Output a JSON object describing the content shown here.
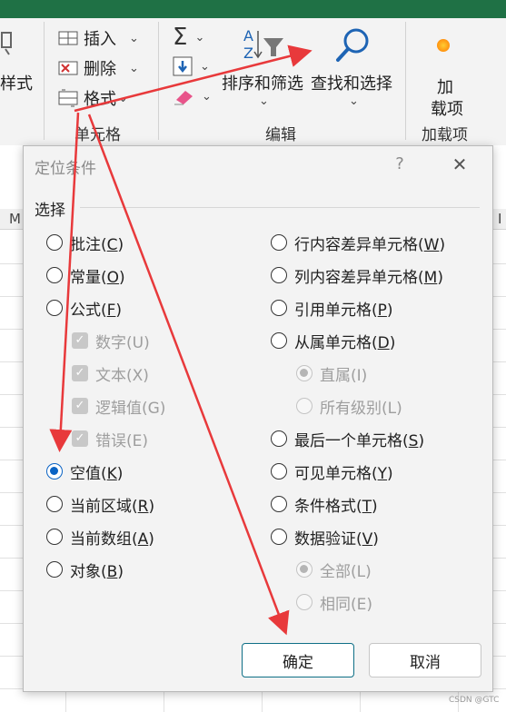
{
  "ribbon": {
    "left_partial_label": "样式",
    "cells_group": {
      "insert": "插入",
      "delete": "删除",
      "format": "格式",
      "label": "单元格"
    },
    "edit_group": {
      "sort_filter": "排序和筛选",
      "find_select": "查找和选择",
      "label": "编辑"
    },
    "addins_group": {
      "addins_line1": "加",
      "addins_line2": "载项",
      "label": "加载项"
    },
    "sheet_col_left": "M",
    "sheet_col_right": "I"
  },
  "dialog": {
    "title": "定位条件",
    "help": "?",
    "close": "✕",
    "section_label": "选择",
    "left_options": [
      {
        "text": "批注(",
        "key": "C",
        "tail": ")",
        "type": "radio",
        "checked": false,
        "disabled": false
      },
      {
        "text": "常量(",
        "key": "O",
        "tail": ")",
        "type": "radio",
        "checked": false,
        "disabled": false
      },
      {
        "text": "公式(",
        "key": "F",
        "tail": ")",
        "type": "radio",
        "checked": false,
        "disabled": false
      },
      {
        "text": "数字(U)",
        "type": "checkbox",
        "checked": true,
        "disabled": true
      },
      {
        "text": "文本(X)",
        "type": "checkbox",
        "checked": true,
        "disabled": true
      },
      {
        "text": "逻辑值(G)",
        "type": "checkbox",
        "checked": true,
        "disabled": true
      },
      {
        "text": "错误(E)",
        "type": "checkbox",
        "checked": true,
        "disabled": true
      },
      {
        "text": "空值(",
        "key": "K",
        "tail": ")",
        "type": "radio",
        "checked": true,
        "disabled": false
      },
      {
        "text": "当前区域(",
        "key": "R",
        "tail": ")",
        "type": "radio",
        "checked": false,
        "disabled": false
      },
      {
        "text": "当前数组(",
        "key": "A",
        "tail": ")",
        "type": "radio",
        "checked": false,
        "disabled": false
      },
      {
        "text": "对象(",
        "key": "B",
        "tail": ")",
        "type": "radio",
        "checked": false,
        "disabled": false
      }
    ],
    "right_options": [
      {
        "text": "行内容差异单元格(",
        "key": "W",
        "tail": ")",
        "type": "radio",
        "checked": false,
        "disabled": false
      },
      {
        "text": "列内容差异单元格(",
        "key": "M",
        "tail": ")",
        "type": "radio",
        "checked": false,
        "disabled": false
      },
      {
        "text": "引用单元格(",
        "key": "P",
        "tail": ")",
        "type": "radio",
        "checked": false,
        "disabled": false
      },
      {
        "text": "从属单元格(",
        "key": "D",
        "tail": ")",
        "type": "radio",
        "checked": false,
        "disabled": false
      },
      {
        "text": "直属(I)",
        "type": "radio",
        "checked": true,
        "disabled": true
      },
      {
        "text": "所有级别(L)",
        "type": "radio",
        "checked": false,
        "disabled": true
      },
      {
        "text": "最后一个单元格(",
        "key": "S",
        "tail": ")",
        "type": "radio",
        "checked": false,
        "disabled": false
      },
      {
        "text": "可见单元格(",
        "key": "Y",
        "tail": ")",
        "type": "radio",
        "checked": false,
        "disabled": false
      },
      {
        "text": "条件格式(",
        "key": "T",
        "tail": ")",
        "type": "radio",
        "checked": false,
        "disabled": false
      },
      {
        "text": "数据验证(",
        "key": "V",
        "tail": ")",
        "type": "radio",
        "checked": false,
        "disabled": false
      },
      {
        "text": "全部(L)",
        "type": "radio",
        "checked": true,
        "disabled": true
      },
      {
        "text": "相同(E)",
        "type": "radio",
        "checked": false,
        "disabled": true
      }
    ],
    "ok": "确定",
    "cancel": "取消"
  },
  "watermark": "CSDN @GTC",
  "colors": {
    "accent": "#0a63c4",
    "arrow": "#e8393b",
    "excel_green": "#1f7145"
  }
}
